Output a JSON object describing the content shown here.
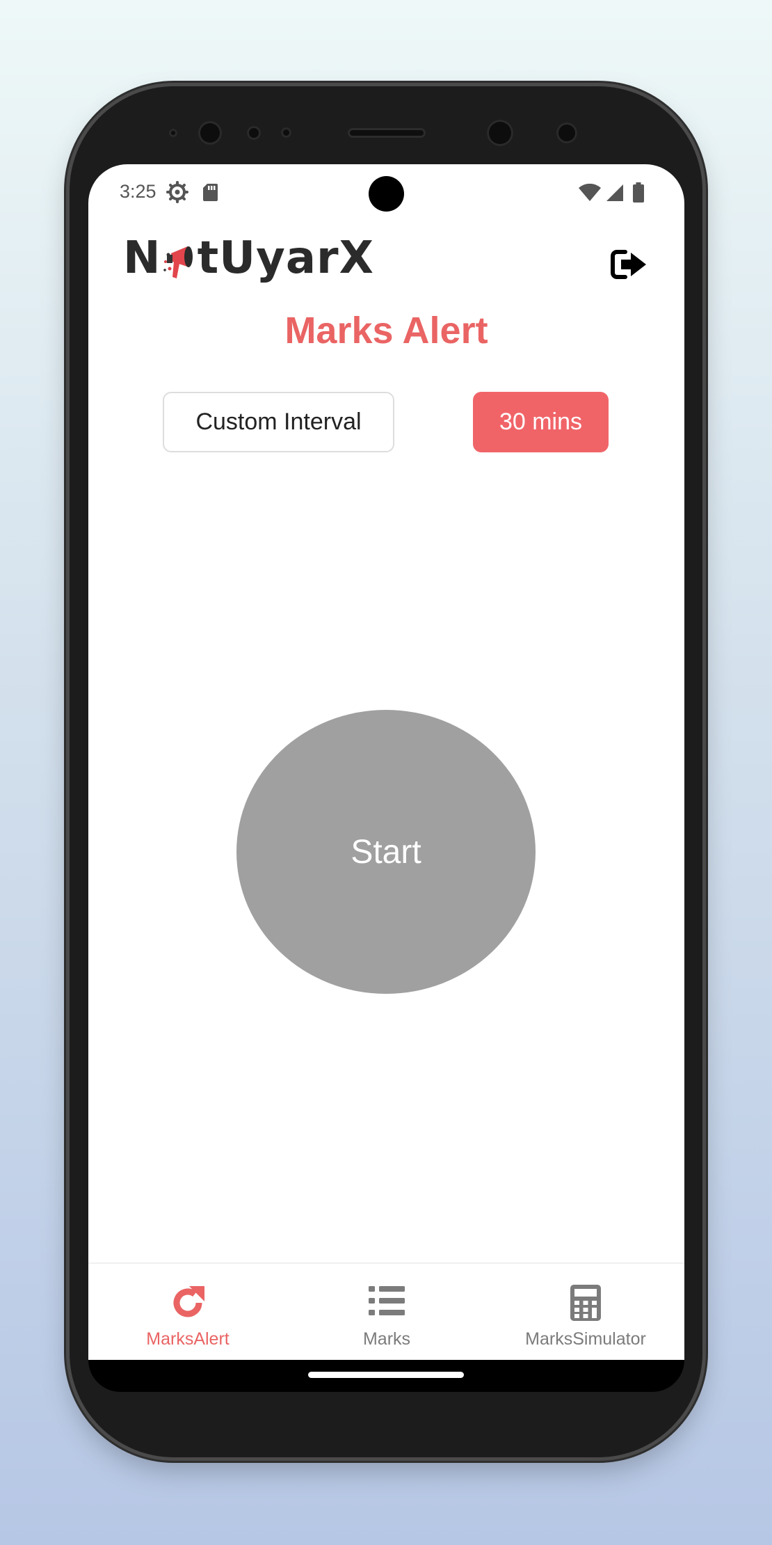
{
  "status_bar": {
    "time": "3:25",
    "icons": [
      "gear-icon",
      "sd-card-icon",
      "wifi-icon",
      "signal-icon",
      "battery-icon"
    ]
  },
  "header": {
    "logo_text_start": "N",
    "logo_text_end": "tUyarX",
    "logout_icon": "logout-icon"
  },
  "page": {
    "title": "Marks Alert"
  },
  "interval": {
    "custom_label": "Custom Interval",
    "selected_label": "30 mins"
  },
  "start": {
    "label": "Start"
  },
  "bottom_nav": {
    "items": [
      {
        "label": "MarksAlert",
        "icon": "refresh-icon",
        "active": true
      },
      {
        "label": "Marks",
        "icon": "list-icon",
        "active": false
      },
      {
        "label": "MarksSimulator",
        "icon": "calculator-icon",
        "active": false
      }
    ]
  },
  "colors": {
    "accent": "#ea6464",
    "button_accent": "#f06468",
    "start_button": "#a0a0a0",
    "inactive_nav": "#7b7b7b"
  }
}
